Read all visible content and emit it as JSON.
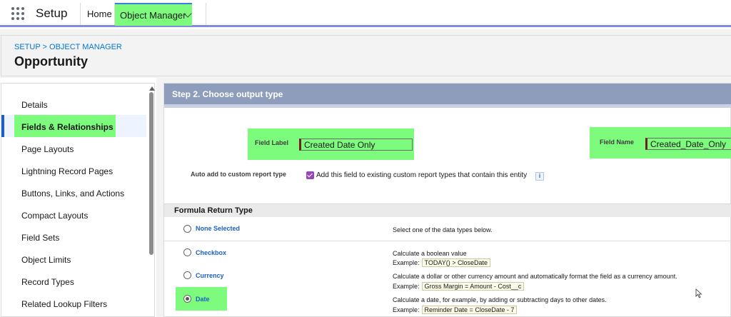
{
  "app": {
    "name": "Setup"
  },
  "nav": {
    "home": "Home",
    "object_manager": "Object Manager"
  },
  "breadcrumb": "SETUP > OBJECT MANAGER",
  "page_title": "Opportunity",
  "sidebar": {
    "items": [
      {
        "label": "Details"
      },
      {
        "label": "Fields & Relationships",
        "active": true
      },
      {
        "label": "Page Layouts"
      },
      {
        "label": "Lightning Record Pages"
      },
      {
        "label": "Buttons, Links, and Actions"
      },
      {
        "label": "Compact Layouts"
      },
      {
        "label": "Field Sets"
      },
      {
        "label": "Object Limits"
      },
      {
        "label": "Record Types"
      },
      {
        "label": "Related Lookup Filters"
      }
    ]
  },
  "step": {
    "title": "Step 2. Choose output type"
  },
  "field_label": {
    "label": "Field Label",
    "value": "Created Date Only"
  },
  "field_name": {
    "label": "Field Name",
    "value": "Created_Date_Only"
  },
  "report_type": {
    "label": "Auto add to custom report type",
    "checkbox_text": "Add this field to existing custom report types that contain this entity",
    "checked": true,
    "info": "i"
  },
  "formula": {
    "section_title": "Formula Return Type",
    "example_label": "Example:",
    "types": [
      {
        "name": "None Selected",
        "selected": false,
        "desc": "Select one of the data types below.",
        "example": ""
      },
      {
        "name": "Checkbox",
        "selected": false,
        "desc": "Calculate a boolean value",
        "example": "TODAY() > CloseDate"
      },
      {
        "name": "Currency",
        "selected": false,
        "desc": "Calculate a dollar or other currency amount and automatically format the field as a currency amount.",
        "example": "Gross Margin = Amount - Cost__c"
      },
      {
        "name": "Date",
        "selected": true,
        "desc": "Calculate a date, for example, by adding or subtracting days to other dates.",
        "example": "Reminder Date = CloseDate - 7"
      }
    ]
  },
  "colors": {
    "highlight": "#7dfb7d",
    "accent": "#1b5fc7",
    "step_bar": "#8e9dbb",
    "checkbox": "#9648b8"
  },
  "icons": [
    "app-launcher-icon",
    "chevron-down-icon",
    "info-icon",
    "mouse-cursor-icon"
  ]
}
